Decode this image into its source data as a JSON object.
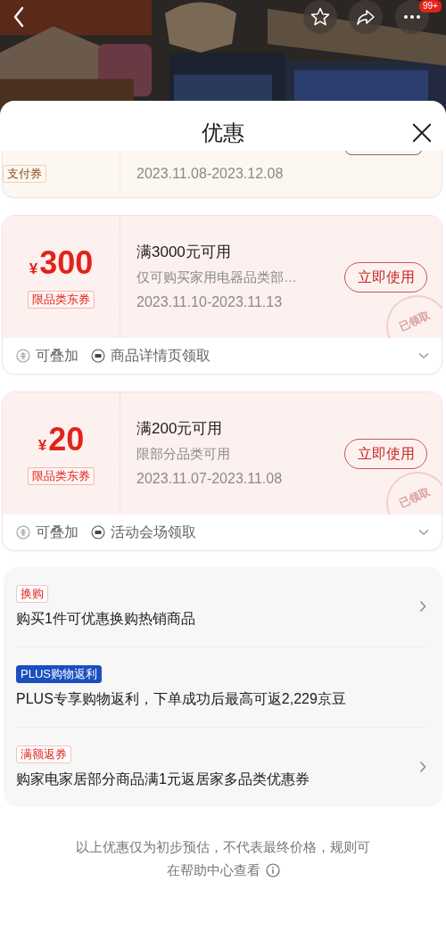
{
  "nav": {
    "badge": "99+"
  },
  "sheet": {
    "title": "优惠"
  },
  "coupons": [
    {
      "kind": "cut",
      "tag": "支付券",
      "date": "2023.11.08-2023.12.08"
    },
    {
      "kind": "full",
      "symbol": "¥",
      "amount": "300",
      "tag": "限品类东券",
      "title": "满3000元可用",
      "desc": "仅可购买家用电器品类部…",
      "date": "2023.11.10-2023.11.13",
      "button": "立即使用",
      "stamp": "已领取",
      "stackable": "可叠加",
      "source": "商品详情页领取"
    },
    {
      "kind": "full",
      "symbol": "¥",
      "amount": "20",
      "tag": "限品类东券",
      "title": "满200元可用",
      "desc": "限部分品类可用",
      "date": "2023.11.07-2023.11.08",
      "button": "立即使用",
      "stamp": "已领取",
      "stackable": "可叠加",
      "source": "活动会场领取"
    }
  ],
  "offers": [
    {
      "kind": "outline",
      "tag": "换购",
      "text": "购买1件可优惠换购热销商品",
      "link": true
    },
    {
      "kind": "plus",
      "tag": "PLUS购物返利",
      "text": "PLUS专享购物返利，下单成功后最高可返2,229京豆",
      "link": false
    },
    {
      "kind": "outline",
      "tag": "满额返券",
      "text": "购家电家居部分商品满1元返居家多品类优惠券",
      "link": true
    }
  ],
  "footer": {
    "note": "以上优惠仅为初步预估，不代表最终价格，规则可",
    "link": "在帮助中心查看"
  }
}
